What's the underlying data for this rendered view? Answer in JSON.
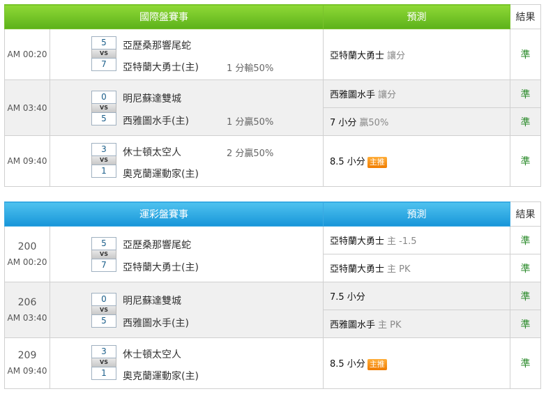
{
  "international": {
    "header": {
      "title": "國際盤賽事",
      "prediction": "預測",
      "result": "結果"
    },
    "games": [
      {
        "time": "AM 00:20",
        "away": {
          "score": "5",
          "name": "亞歷桑那響尾蛇"
        },
        "vs": "VS",
        "home": {
          "score": "7",
          "name": "亞特蘭大勇士(主)"
        },
        "odds": "1 分輸50%",
        "predictions": [
          {
            "main": "亞特蘭大勇士",
            "sub": "讓分",
            "tag": "",
            "result": "準"
          }
        ]
      },
      {
        "time": "AM 03:40",
        "away": {
          "score": "0",
          "name": "明尼蘇達雙城"
        },
        "vs": "VS",
        "home": {
          "score": "5",
          "name": "西雅圖水手(主)"
        },
        "odds": "1 分贏50%",
        "predictions": [
          {
            "main": "西雅圖水手",
            "sub": "讓分",
            "tag": "",
            "result": "準"
          },
          {
            "main": "7 小分",
            "sub": "贏50%",
            "tag": "",
            "result": "準"
          }
        ]
      },
      {
        "time": "AM 09:40",
        "away": {
          "score": "3",
          "name": "休士頓太空人"
        },
        "vs": "VS",
        "home": {
          "score": "1",
          "name": "奧克蘭運動家(主)"
        },
        "odds": "2 分贏50%",
        "predictions": [
          {
            "main": "8.5 小分",
            "sub": "",
            "tag": "主推",
            "result": "準"
          }
        ]
      }
    ]
  },
  "lottery": {
    "header": {
      "title": "運彩盤賽事",
      "prediction": "預測",
      "result": "結果"
    },
    "games": [
      {
        "num": "200",
        "time": "AM 00:20",
        "away": {
          "score": "5",
          "name": "亞歷桑那響尾蛇"
        },
        "vs": "VS",
        "home": {
          "score": "7",
          "name": "亞特蘭大勇士(主)"
        },
        "predictions": [
          {
            "main": "亞特蘭大勇士",
            "sub": "主 -1.5",
            "tag": "",
            "result": "準"
          },
          {
            "main": "亞特蘭大勇士",
            "sub": "主 PK",
            "tag": "",
            "result": "準"
          }
        ]
      },
      {
        "num": "206",
        "time": "AM 03:40",
        "away": {
          "score": "0",
          "name": "明尼蘇達雙城"
        },
        "vs": "VS",
        "home": {
          "score": "5",
          "name": "西雅圖水手(主)"
        },
        "predictions": [
          {
            "main": "7.5 小分",
            "sub": "",
            "tag": "",
            "result": "準"
          },
          {
            "main": "西雅圖水手",
            "sub": "主 PK",
            "tag": "",
            "result": "準"
          }
        ]
      },
      {
        "num": "209",
        "time": "AM 09:40",
        "away": {
          "score": "3",
          "name": "休士頓太空人"
        },
        "vs": "VS",
        "home": {
          "score": "1",
          "name": "奧克蘭運動家(主)"
        },
        "predictions": [
          {
            "main": "8.5 小分",
            "sub": "",
            "tag": "主推",
            "result": "準"
          }
        ]
      }
    ]
  }
}
